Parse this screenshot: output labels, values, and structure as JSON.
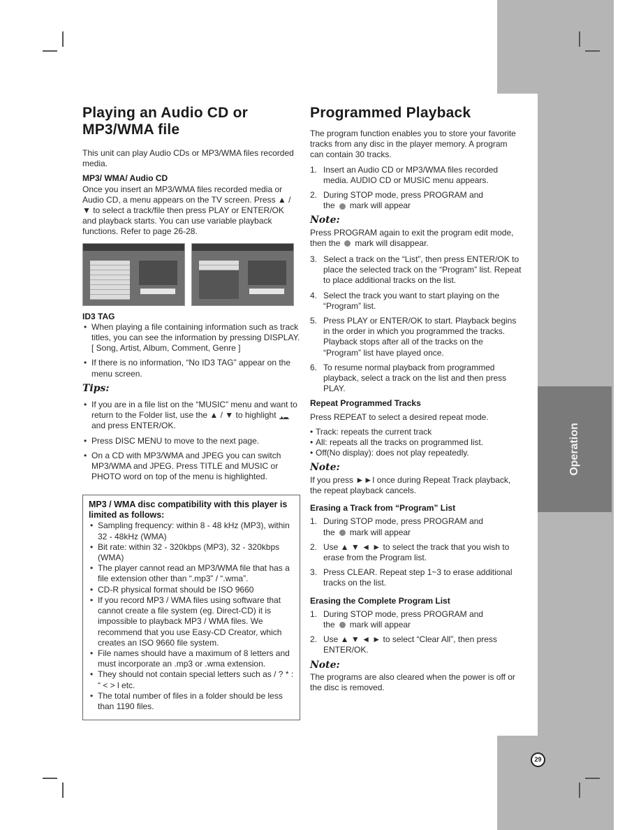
{
  "page": {
    "number": "29",
    "section_tab": "Operation",
    "colors": {
      "band": "#b5b5b5",
      "tab": "#7a7a7a",
      "text": "#2a2a2a"
    }
  },
  "left": {
    "title": "Playing an Audio CD or MP3/WMA file",
    "intro": "This unit can play Audio CDs or MP3/WMA files recorded media.",
    "mp3_heading": "MP3/ WMA/ Audio CD",
    "mp3_text": "Once you insert an MP3/WMA files recorded media or Audio CD, a menu appears on the TV screen. Press ▲ / ▼ to select a track/file then press PLAY or ENTER/OK and playback starts. You can use variable playback functions. Refer to page 26-28.",
    "id3_heading": "ID3 TAG",
    "id3_items": [
      "When playing a file containing information such as track titles, you can see the information by pressing DISPLAY. [ Song, Artist, Album, Comment, Genre ]",
      "If there is no information, “No ID3 TAG” appear on the menu screen."
    ],
    "tips_heading": "Tips:",
    "tip1_before": "If you are in a file list on the “MUSIC” menu and want to return to the Folder list, use the ▲ / ▼ to highlight",
    "tip1_after": "and press ENTER/OK.",
    "tips_items": [
      "Press DISC MENU to move to the next page.",
      "On a CD with MP3/WMA and JPEG you can switch MP3/WMA and JPEG. Press TITLE and MUSIC or PHOTO word on top of the menu is highlighted."
    ],
    "box_heading": "MP3 / WMA disc compatibility with this player is limited as follows:",
    "box_items": [
      "Sampling frequency: within 8 - 48 kHz (MP3), within 32 - 48kHz (WMA)",
      "Bit rate: within 32 - 320kbps (MP3), 32 - 320kbps (WMA)",
      "The player cannot read an MP3/WMA file that has a file extension other than “.mp3” / “.wma”.",
      "CD-R physical format should be ISO 9660",
      "If you record MP3 / WMA files using software that cannot create a file system (eg. Direct-CD) it is impossible to playback MP3 / WMA files. We recommend that you use Easy-CD Creator, which creates an ISO 9660 file system.",
      "File names should have a maximum of 8 letters and must incorporate an .mp3 or .wma extension.",
      "They should not contain special letters such as / ? * : “ < > l etc.",
      "The total number of files in a folder should be less than 1190 files."
    ]
  },
  "right": {
    "title": "Programmed Playback",
    "intro": "The program function enables you to store your favorite tracks from any disc in the player memory. A program can contain 30 tracks.",
    "steps_a": [
      {
        "num": "1.",
        "text": "Insert an Audio CD or MP3/WMA files recorded media. AUDIO CD or MUSIC menu appears."
      },
      {
        "num": "2.",
        "text": "During STOP mode, press PROGRAM and",
        "tail": "mark will appear"
      }
    ],
    "the_word": "the",
    "note_label": "Note:",
    "note1_before": "Press PROGRAM again to exit the program edit mode, then the",
    "note1_after": "mark will disappear.",
    "steps_b": [
      {
        "num": "3.",
        "text": "Select a track on the “List”, then press ENTER/OK to place the selected track on the “Program” list. Repeat to place additional tracks on the list."
      },
      {
        "num": "4.",
        "text": "Select the track you want to start playing on the “Program” list."
      },
      {
        "num": "5.",
        "text": "Press PLAY or ENTER/OK to start. Playback begins in the order in which you programmed the tracks. Playback stops after all of the tracks on the “Program” list have played once."
      },
      {
        "num": "6.",
        "text": "To resume normal playback from programmed playback, select a track on the list and then press PLAY."
      }
    ],
    "repeat_heading": "Repeat Programmed Tracks",
    "repeat_text": "Press REPEAT to select a desired repeat mode.",
    "repeat_items": [
      "Track: repeats the current track",
      "All: repeats all the tracks on programmed list.",
      "Off(No display): does not play repeatedly."
    ],
    "note2": "If you press ►►I once during Repeat Track playback, the repeat playback cancels.",
    "erase_heading": "Erasing a Track from “Program” List",
    "erase_steps": [
      {
        "num": "1.",
        "text": "During STOP mode, press PROGRAM and",
        "tail": "mark will appear"
      },
      {
        "num": "2.",
        "text": "Use ▲ ▼ ◄ ► to select the track that you wish to erase from the Program list."
      },
      {
        "num": "3.",
        "text": "Press CLEAR. Repeat step 1~3 to erase additional tracks on the list."
      }
    ],
    "clear_heading": "Erasing the Complete Program List",
    "clear_steps": [
      {
        "num": "1.",
        "text": "During STOP mode, press PROGRAM and",
        "tail": "mark will appear"
      },
      {
        "num": "2.",
        "text": "Use ▲ ▼ ◄ ► to select “Clear All”, then press ENTER/OK."
      }
    ],
    "note3": "The programs are also cleared when the power is off or the disc is removed."
  }
}
